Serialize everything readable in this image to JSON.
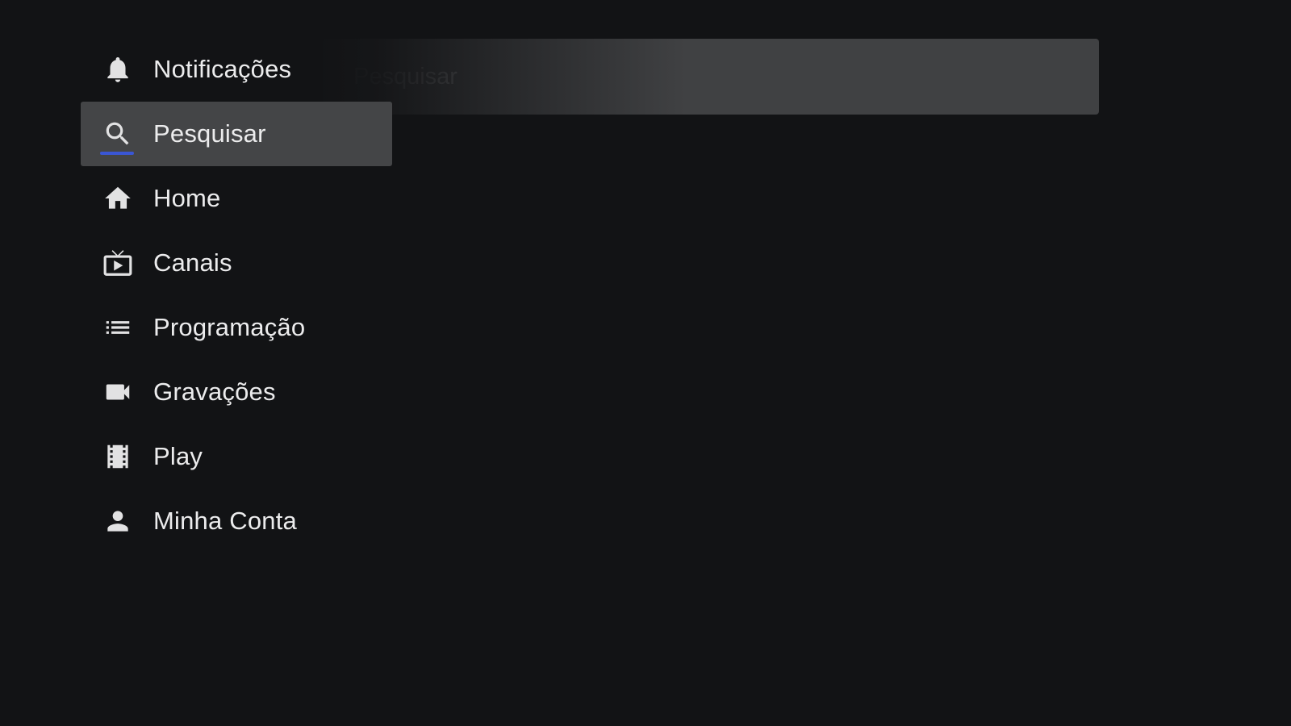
{
  "search": {
    "placeholder": "Pesquisar"
  },
  "menu": {
    "items": [
      {
        "label": "Notificações",
        "icon": "bell-icon"
      },
      {
        "label": "Pesquisar",
        "icon": "search-icon",
        "selected": true
      },
      {
        "label": "Home",
        "icon": "home-icon"
      },
      {
        "label": "Canais",
        "icon": "tv-icon"
      },
      {
        "label": "Programação",
        "icon": "list-icon"
      },
      {
        "label": "Gravações",
        "icon": "video-camera-icon"
      },
      {
        "label": "Play",
        "icon": "film-icon"
      },
      {
        "label": "Minha Conta",
        "icon": "person-icon"
      }
    ]
  },
  "colors": {
    "background": "#121315",
    "selected_item": "#444547",
    "focus_accent": "#3a56d4",
    "search_bar": "#404143"
  }
}
